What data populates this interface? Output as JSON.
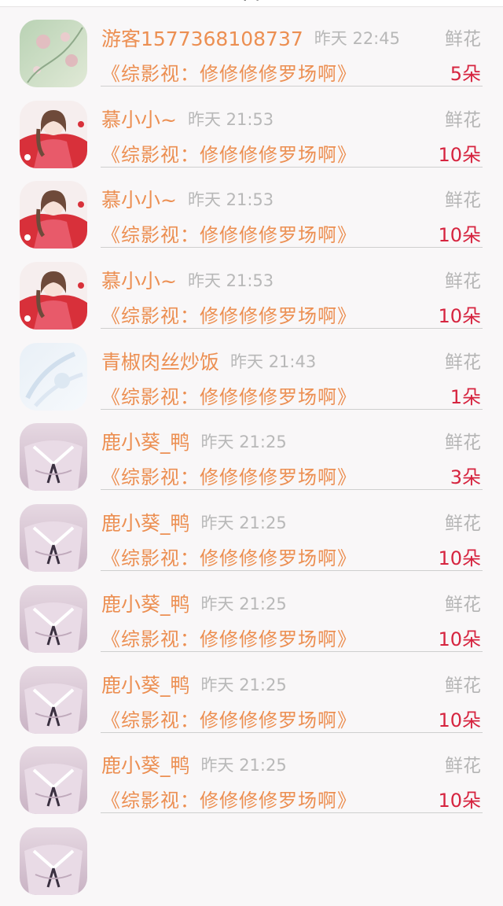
{
  "header": {
    "title": "鲜花"
  },
  "rows": [
    {
      "avatar": "flower-blossom-avatar",
      "name": "游客1577368108737",
      "time": "昨天 22:45",
      "kind": "鲜花",
      "book": "《综影视：修修修修罗场啊》",
      "count": "5朵"
    },
    {
      "avatar": "red-dress-girl-avatar",
      "name": "慕小小~",
      "time": "昨天 21:53",
      "kind": "鲜花",
      "book": "《综影视：修修修修罗场啊》",
      "count": "10朵"
    },
    {
      "avatar": "red-dress-girl-avatar",
      "name": "慕小小~",
      "time": "昨天 21:53",
      "kind": "鲜花",
      "book": "《综影视：修修修修罗场啊》",
      "count": "10朵"
    },
    {
      "avatar": "red-dress-girl-avatar",
      "name": "慕小小~",
      "time": "昨天 21:53",
      "kind": "鲜花",
      "book": "《综影视：修修修修罗场啊》",
      "count": "10朵"
    },
    {
      "avatar": "pale-blue-avatar",
      "name": "青椒肉丝炒饭",
      "time": "昨天 21:43",
      "kind": "鲜花",
      "book": "《综影视：修修修修罗场啊》",
      "count": "1朵"
    },
    {
      "avatar": "sailor-girl-avatar",
      "name": "鹿小葵_鸭",
      "time": "昨天 21:25",
      "kind": "鲜花",
      "book": "《综影视：修修修修罗场啊》",
      "count": "3朵"
    },
    {
      "avatar": "sailor-girl-avatar",
      "name": "鹿小葵_鸭",
      "time": "昨天 21:25",
      "kind": "鲜花",
      "book": "《综影视：修修修修罗场啊》",
      "count": "10朵"
    },
    {
      "avatar": "sailor-girl-avatar",
      "name": "鹿小葵_鸭",
      "time": "昨天 21:25",
      "kind": "鲜花",
      "book": "《综影视：修修修修罗场啊》",
      "count": "10朵"
    },
    {
      "avatar": "sailor-girl-avatar",
      "name": "鹿小葵_鸭",
      "time": "昨天 21:25",
      "kind": "鲜花",
      "book": "《综影视：修修修修罗场啊》",
      "count": "10朵"
    },
    {
      "avatar": "sailor-girl-avatar",
      "name": "鹿小葵_鸭",
      "time": "昨天 21:25",
      "kind": "鲜花",
      "book": "《综影视：修修修修罗场啊》",
      "count": "10朵"
    },
    {
      "avatar": "sailor-girl-avatar",
      "name": "",
      "time": "",
      "kind": "",
      "book": "",
      "count": ""
    }
  ],
  "colors": {
    "accent": "#ec8f52",
    "count": "#d6243f",
    "muted": "#b5b5b5",
    "background": "#f9f7f8"
  }
}
